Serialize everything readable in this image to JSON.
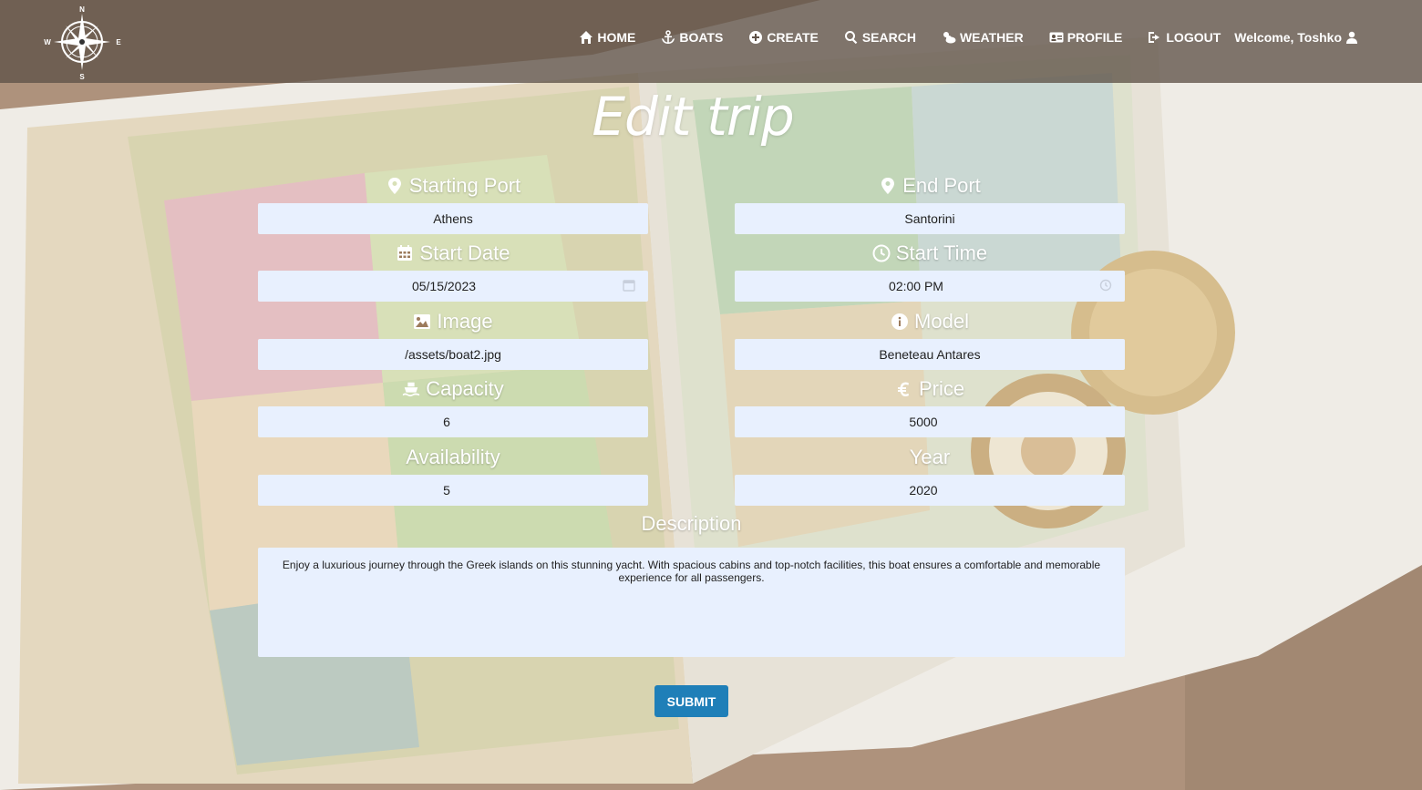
{
  "nav": {
    "items": [
      {
        "label": "HOME",
        "icon": "home-icon"
      },
      {
        "label": "BOATS",
        "icon": "anchor-icon"
      },
      {
        "label": "CREATE",
        "icon": "plus-circle-icon"
      },
      {
        "label": "SEARCH",
        "icon": "search-icon"
      },
      {
        "label": "WEATHER",
        "icon": "cloud-sun-icon"
      },
      {
        "label": "PROFILE",
        "icon": "id-card-icon"
      },
      {
        "label": "LOGOUT",
        "icon": "logout-icon"
      }
    ],
    "welcome": "Welcome, Toshko",
    "logo_letters": {
      "n": "N",
      "s": "S",
      "e": "E",
      "w": "W"
    }
  },
  "page": {
    "title": "Edit trip"
  },
  "form": {
    "starting_port": {
      "label": "Starting Port",
      "value": "Athens",
      "icon": "map-marker-icon"
    },
    "end_port": {
      "label": "End Port",
      "value": "Santorini",
      "icon": "map-marker-icon"
    },
    "start_date": {
      "label": "Start Date",
      "value": "05/15/2023",
      "icon": "calendar-icon"
    },
    "start_time": {
      "label": "Start Time",
      "value": "02:00 PM",
      "icon": "clock-icon"
    },
    "image": {
      "label": "Image",
      "value": "/assets/boat2.jpg",
      "icon": "image-icon"
    },
    "model": {
      "label": "Model",
      "value": "Beneteau Antares",
      "icon": "info-circle-icon"
    },
    "capacity": {
      "label": "Capacity",
      "value": "6",
      "icon": "ship-icon"
    },
    "price": {
      "label": "Price",
      "value": "5000",
      "icon": "euro-icon"
    },
    "availability": {
      "label": "Availability",
      "value": "5"
    },
    "year": {
      "label": "Year",
      "value": "2020"
    },
    "description": {
      "label": "Description",
      "value": "Enjoy a luxurious journey through the Greek islands on this stunning yacht. With spacious cabins and top-notch facilities, this boat ensures a comfortable and memorable experience for all passengers."
    },
    "submit_label": "SUBMIT"
  },
  "colors": {
    "navbar": "#5f5248",
    "input_bg": "#e8f0fe",
    "submit_bg": "#1f7fb8"
  }
}
